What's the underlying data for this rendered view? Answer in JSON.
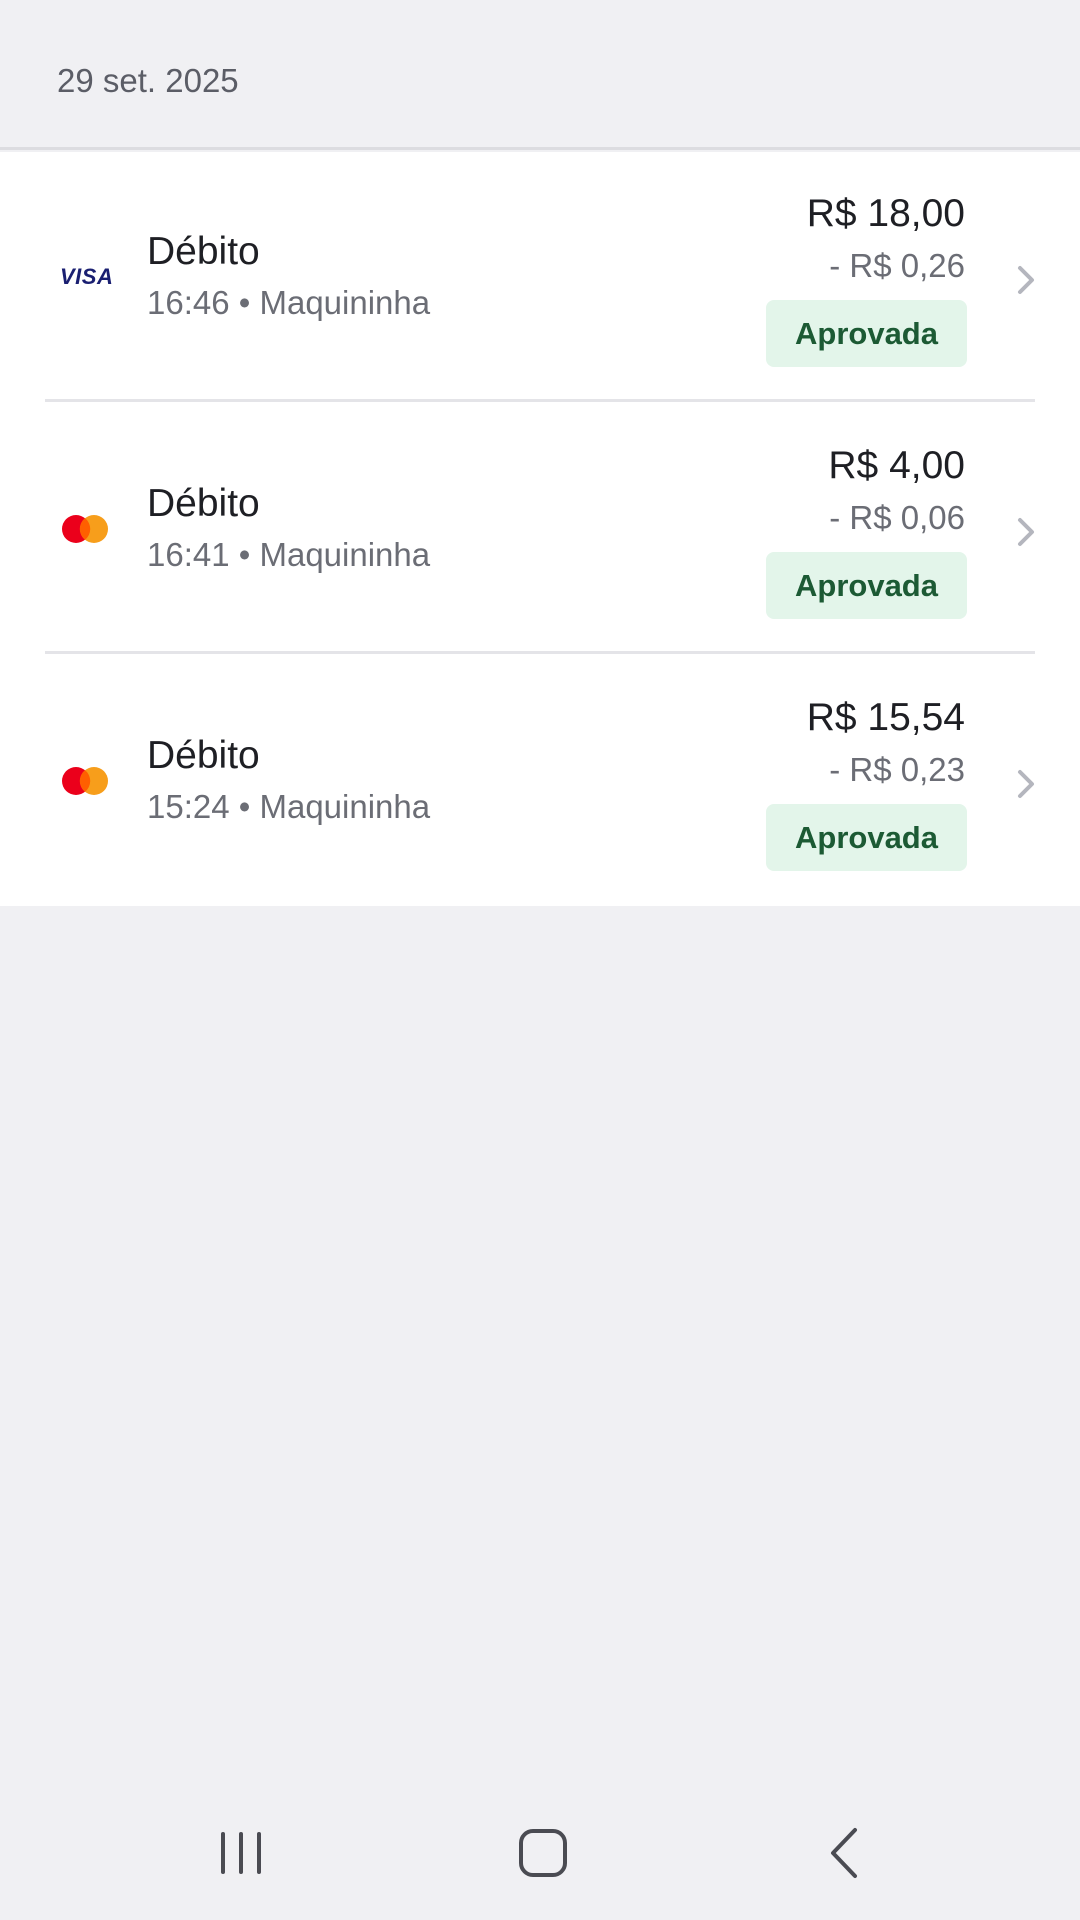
{
  "date_header": "29 set. 2025",
  "transactions": [
    {
      "brand": "visa",
      "brand_label": "VISA",
      "title": "Débito",
      "subtitle": "16:46 • Maquininha",
      "amount": "R$ 18,00",
      "fee": "- R$ 0,26",
      "status": "Aprovada"
    },
    {
      "brand": "mastercard",
      "title": "Débito",
      "subtitle": "16:41 • Maquininha",
      "amount": "R$ 4,00",
      "fee": "- R$ 0,06",
      "status": "Aprovada"
    },
    {
      "brand": "mastercard",
      "title": "Débito",
      "subtitle": "15:24 • Maquininha",
      "amount": "R$ 15,54",
      "fee": "- R$ 0,23",
      "status": "Aprovada"
    }
  ],
  "icons": {
    "row_chevron": "chevron-right-icon",
    "nav_recent": "recent-apps-icon",
    "nav_home": "home-icon",
    "nav_back": "back-icon"
  },
  "colors": {
    "status_bg": "#e3f5ea",
    "status_text": "#1c5a34",
    "visa_blue": "#1a1f71",
    "mc_red": "#eb001b",
    "mc_orange": "#f79e1b"
  }
}
